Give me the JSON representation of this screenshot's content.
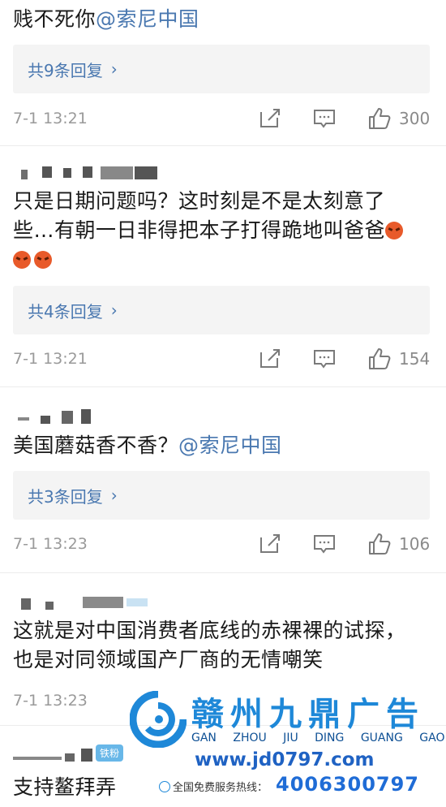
{
  "comments": [
    {
      "text_plain": "贱不死你",
      "mention": "@索尼中国",
      "replies_label": "共9条回复",
      "time": "7-1 13:21",
      "likes": "300"
    },
    {
      "text_line1": "只是日期问题吗？这时刻是不是太刻意了",
      "text_line2": "些…有朝一日非得把本子打得跪地叫爸爸",
      "replies_label": "共4条回复",
      "time": "7-1 13:21",
      "likes": "154"
    },
    {
      "text_plain": "美国蘑菇香不香？",
      "mention": "@索尼中国",
      "replies_label": "共3条回复",
      "time": "7-1 13:23",
      "likes": "106"
    },
    {
      "text_line1": "这就是对中国消费者底线的赤裸裸的试探，",
      "text_line2": "也是对同领域国产厂商的无情嘲笑",
      "time": "7-1 13:23"
    },
    {
      "badge": "铁粉",
      "text_plain": "支持鳌拜弄"
    }
  ],
  "watermark": {
    "brand": "赣州九鼎广告",
    "pinyin": "GAN ZHOU JIU DING GUANG GAO",
    "url": "www.jd0797.com",
    "hotline_label": "全国免费服务热线：",
    "phone": "4006300797"
  },
  "colors": {
    "link": "#4a78b0",
    "reply_bg": "#f4f4f4",
    "meta": "#9a9a9a"
  },
  "icons": [
    "edit-icon",
    "comment-icon",
    "like-icon",
    "angry-emoji-icon"
  ]
}
